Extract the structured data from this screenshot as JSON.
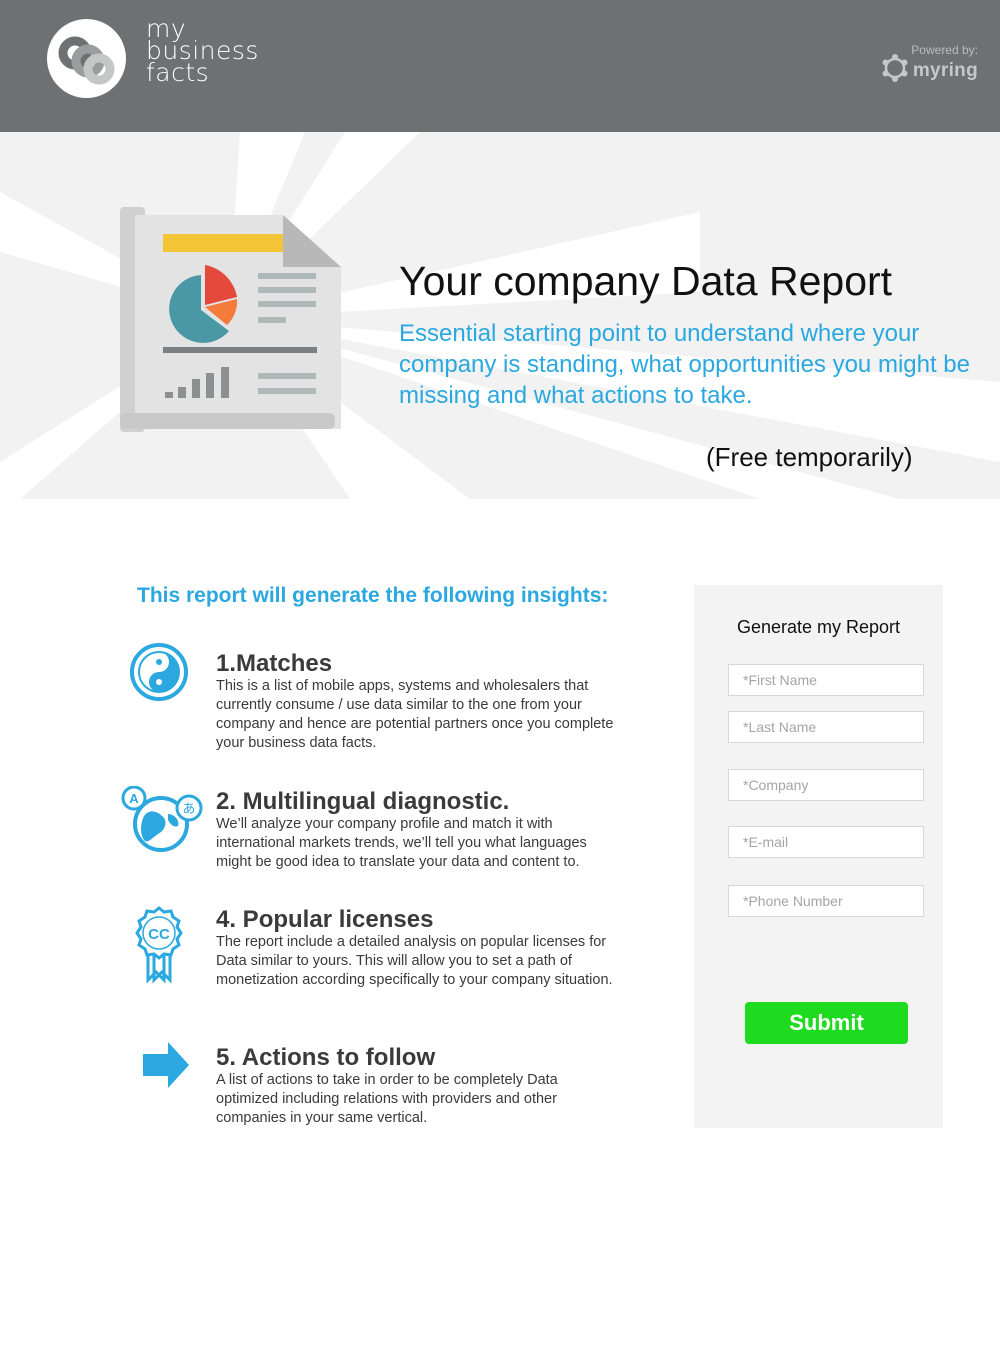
{
  "header": {
    "brand_lines": [
      "my",
      "business",
      "facts"
    ],
    "powered_by": "Powered by:",
    "partner_name": "myring",
    "background": "#6e7171"
  },
  "hero": {
    "title": "Your company Data Report",
    "subtitle": "Essential starting point to understand where your company is standing, what opportunities you might be missing and what actions to take.",
    "note": "(Free temporarily)",
    "illustration": "report-document-icon",
    "accent_color": "#2aa8df"
  },
  "insights": {
    "heading": "This report will generate the following insights:",
    "items": [
      {
        "icon": "yin-yang-icon",
        "title": "1.Matches",
        "description": "This is a list of mobile apps, systems and wholesalers that currently consume / use data similar to the one from your company and hence are potential partners once you complete your business data facts."
      },
      {
        "icon": "globe-languages-icon",
        "title": "2. Multilingual diagnostic.",
        "description": "We’ll analyze your company profile and match it with international markets trends, we’ll tell you what languages might be good idea to translate your data and content to."
      },
      {
        "icon": "cc-license-badge-icon",
        "title": "4. Popular licenses",
        "description": "The report include a detailed analysis on popular licenses for Data similar to yours. This will allow you to set a path of monetization according specifically to your company situation."
      },
      {
        "icon": "arrow-right-icon",
        "title": "5. Actions to follow",
        "description": "A list of actions to take in order to be completely Data optimized including relations with providers and other companies in your same vertical."
      }
    ]
  },
  "form": {
    "title": "Generate my Report",
    "fields": {
      "first_name": "*First Name",
      "last_name": "*Last Name",
      "company": "*Company",
      "email": "*E-mail",
      "phone": "*Phone Number"
    },
    "submit_label": "Submit",
    "submit_color": "#1fdb1f"
  }
}
